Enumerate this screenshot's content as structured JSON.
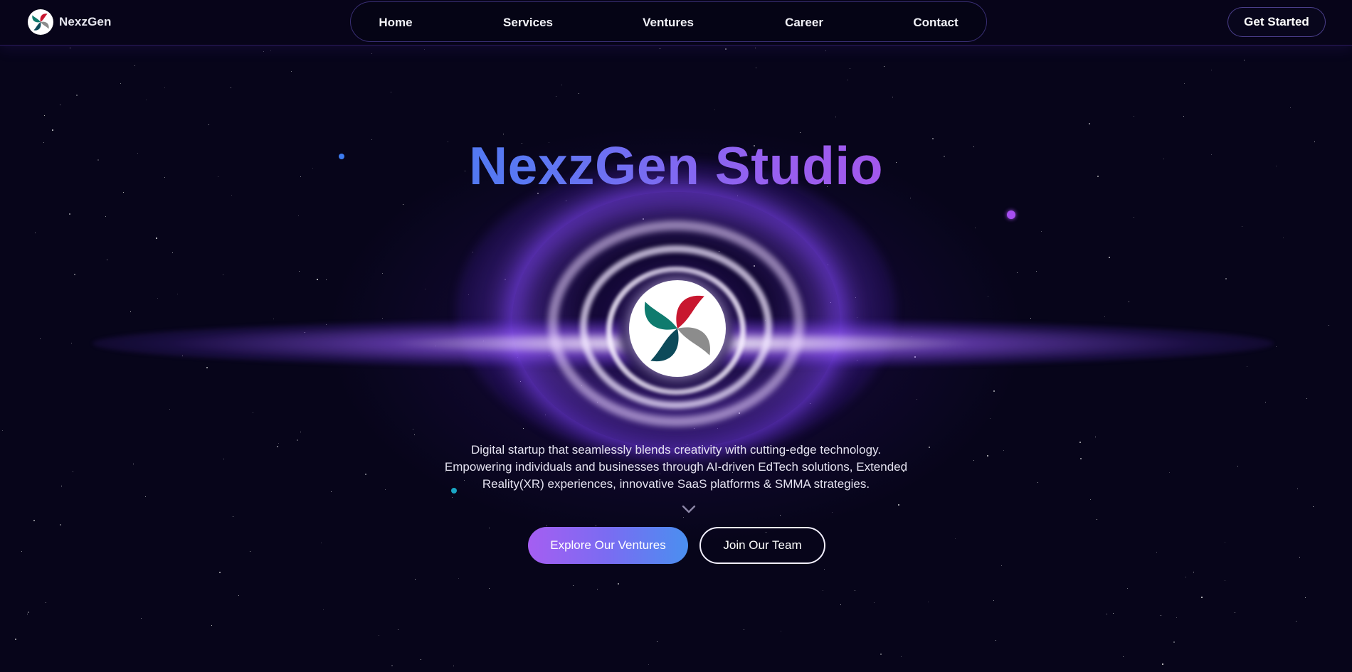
{
  "brand": {
    "name": "NexzGen",
    "logo_icon": "swirl-logo-icon"
  },
  "nav": {
    "items": [
      {
        "label": "Home"
      },
      {
        "label": "Services"
      },
      {
        "label": "Ventures"
      },
      {
        "label": "Career"
      },
      {
        "label": "Contact"
      }
    ]
  },
  "header": {
    "cta_label": "Get Started"
  },
  "hero": {
    "title": "NexzGen Studio",
    "description_lines": [
      "Digital startup that seamlessly blends creativity with cutting-edge technology.",
      "Empowering individuals and businesses through AI-driven EdTech solutions, Extended",
      "Reality(XR) experiences, innovative SaaS platforms & SMMA strategies."
    ],
    "scroll_icon": "chevron-down-icon",
    "primary_button": "Explore Our Ventures",
    "secondary_button": "Join Our Team"
  },
  "colors": {
    "background": "#07051a",
    "title_gradient_start": "#3f7bf0",
    "title_gradient_end": "#b14ee8",
    "glow_purple": "#8a4cff",
    "logo_teal": "#0f7b6e",
    "logo_red": "#c8172f",
    "logo_gray": "#8c8c8c",
    "logo_dark_teal": "#0d4a5a",
    "particle_blue": "#3d7cf0",
    "particle_purple": "#a64ef0",
    "particle_cyan": "#1aa6c4"
  }
}
